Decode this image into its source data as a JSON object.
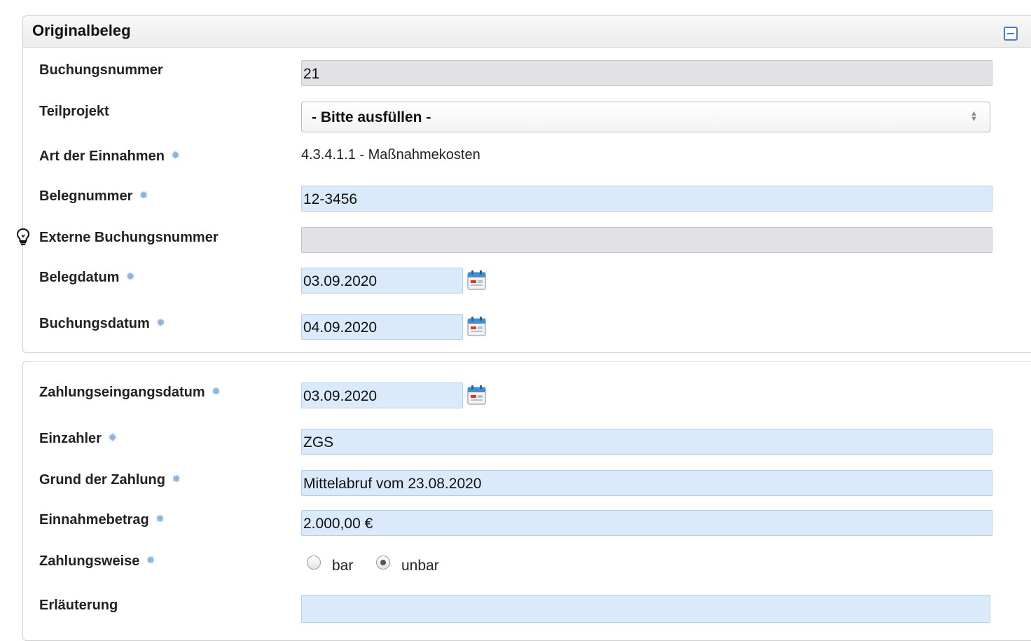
{
  "panel1": {
    "title": "Originalbeleg",
    "fields": {
      "buchungsnummer": {
        "label": "Buchungsnummer",
        "value": "21"
      },
      "teilprojekt": {
        "label": "Teilprojekt",
        "value": "- Bitte ausfüllen -"
      },
      "art_einnahmen": {
        "label": "Art der Einnahmen",
        "value": "4.3.4.1.1 - Maßnahmekosten"
      },
      "belegnummer": {
        "label": "Belegnummer",
        "value": "12-3456"
      },
      "externe_buchungsnummer": {
        "label": "Externe Buchungsnummer",
        "value": ""
      },
      "belegdatum": {
        "label": "Belegdatum",
        "value": "03.09.2020"
      },
      "buchungsdatum": {
        "label": "Buchungsdatum",
        "value": "04.09.2020"
      }
    }
  },
  "panel2": {
    "fields": {
      "zahlungseingangsdatum": {
        "label": "Zahlungseingangsdatum",
        "value": "03.09.2020"
      },
      "einzahler": {
        "label": "Einzahler",
        "value": "ZGS"
      },
      "grund": {
        "label": "Grund der Zahlung",
        "value": "Mittelabruf vom 23.08.2020"
      },
      "betrag": {
        "label": "Einnahmebetrag",
        "value": "2.000,00 €"
      },
      "zahlungsweise": {
        "label": "Zahlungsweise",
        "options": [
          "bar",
          "unbar"
        ],
        "selected": "unbar"
      },
      "erlaeuterung": {
        "label": "Erläuterung",
        "value": ""
      }
    }
  },
  "required_marker": "✹",
  "icons": {
    "collapse": "collapse-icon",
    "calendar": "calendar-icon",
    "hint": "lightbulb-icon"
  },
  "colors": {
    "editable_bg": "#dbeafb",
    "readonly_bg": "#e2e2e6",
    "required_marker": "#8fb3dc",
    "accent": "#4a7ec2"
  }
}
